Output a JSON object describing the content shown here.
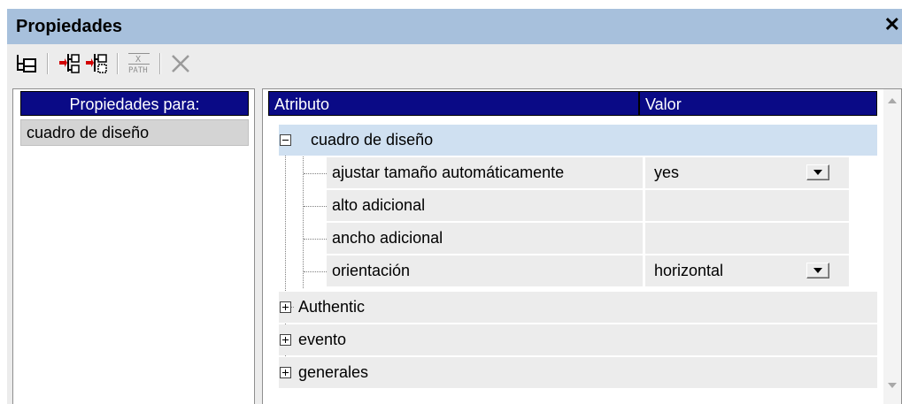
{
  "window": {
    "title": "Propiedades",
    "close_glyph": "✕"
  },
  "toolbar": {
    "buttons": [
      {
        "icon": "tree-view-icon"
      },
      {
        "icon": "insert-element-icon"
      },
      {
        "icon": "insert-element-alt-icon"
      },
      {
        "icon": "xpath-icon",
        "label": "PATH"
      },
      {
        "icon": "delete-icon"
      }
    ]
  },
  "left_panel": {
    "header": "Propiedades para:",
    "items": [
      "cuadro de diseño"
    ]
  },
  "grid": {
    "headers": {
      "attribute": "Atributo",
      "value": "Valor"
    },
    "group_expanded": "cuadro de diseño",
    "rows": [
      {
        "attribute": "ajustar tamaño automáticamente",
        "value": "yes",
        "has_dropdown": true
      },
      {
        "attribute": "alto adicional",
        "value": "",
        "has_dropdown": false
      },
      {
        "attribute": "ancho adicional",
        "value": "",
        "has_dropdown": false
      },
      {
        "attribute": "orientación",
        "value": "horizontal",
        "has_dropdown": true
      }
    ],
    "collapsed_groups": [
      "Authentic",
      "evento",
      "generales"
    ]
  },
  "colors": {
    "titlebar": "#a7c0dc",
    "header_bg": "#0a0a86",
    "group_selected": "#cfe0f1",
    "row_bg": "#ececec"
  }
}
